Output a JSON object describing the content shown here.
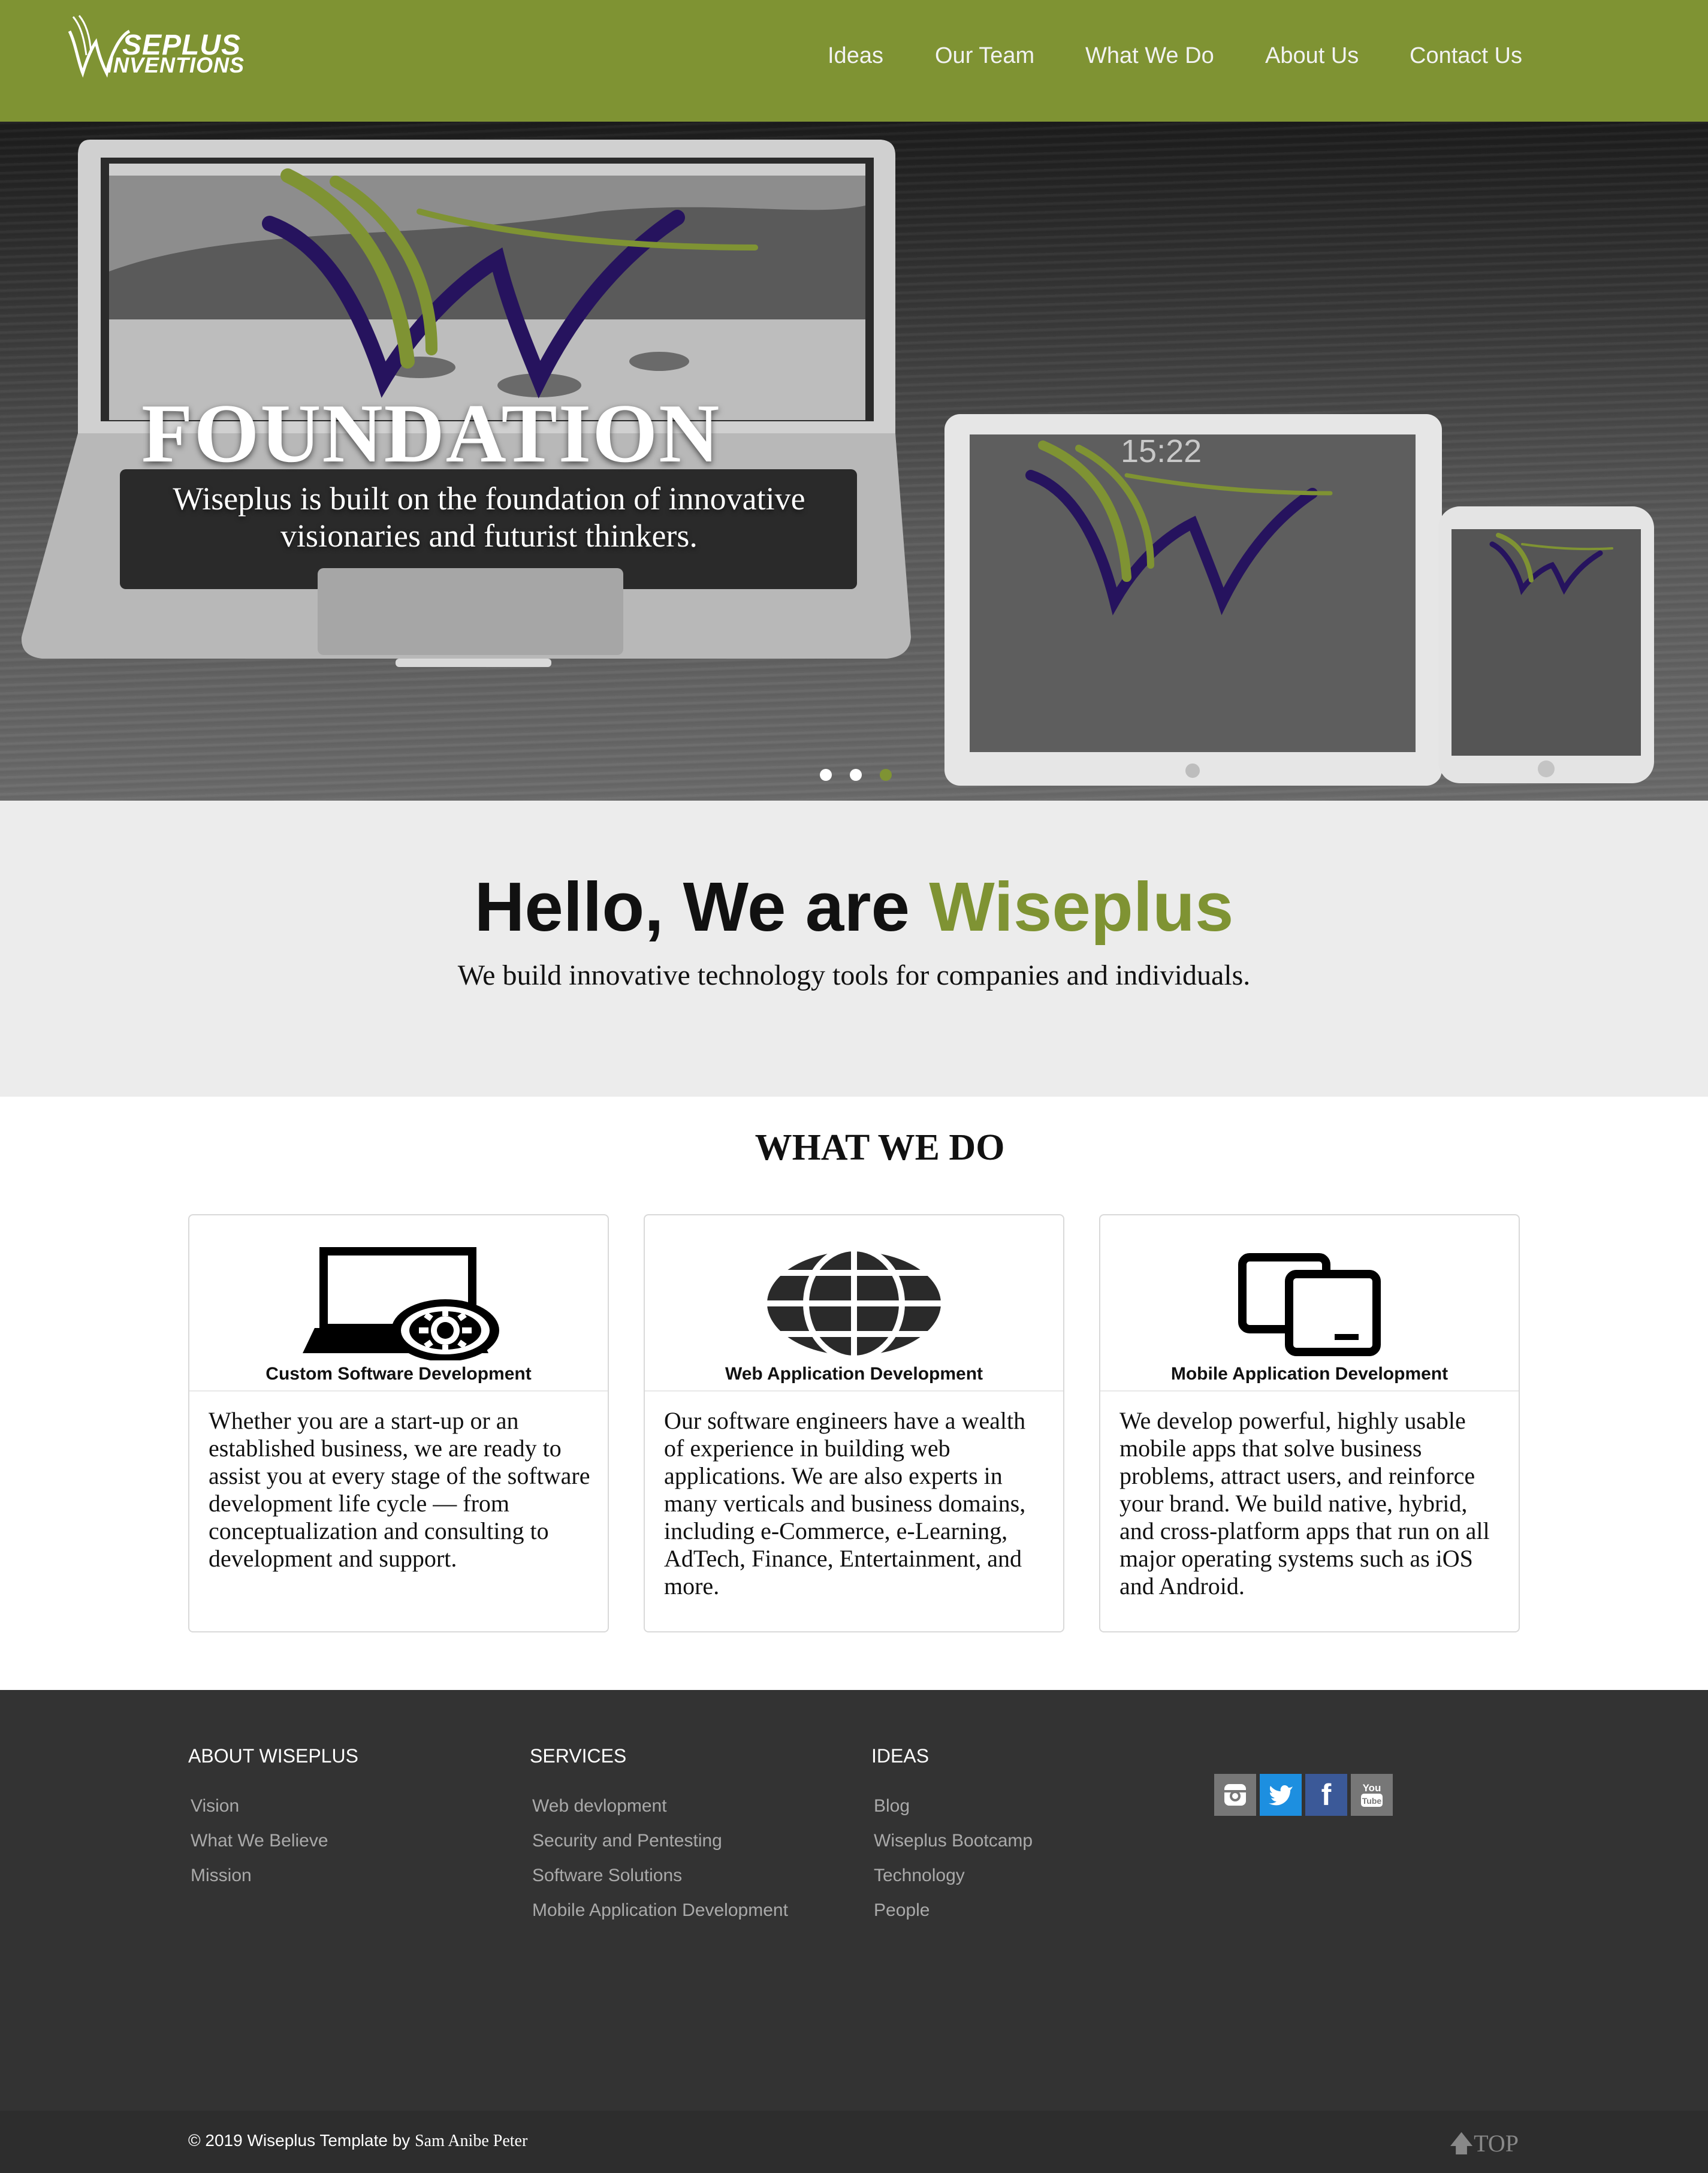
{
  "brand": {
    "logo_line1": "SEPLUS",
    "logo_line2": "INVENTIONS",
    "accent": "#7f9333",
    "dark": "#333333"
  },
  "nav": {
    "items": [
      {
        "label": "Ideas"
      },
      {
        "label": "Our Team"
      },
      {
        "label": "What We Do"
      },
      {
        "label": "About Us"
      },
      {
        "label": "Contact Us"
      }
    ]
  },
  "hero": {
    "title": "FOUNDATION",
    "subtitle": "Wiseplus is built on the foundation of innovative visionaries and futurist thinkers.",
    "slides": 3,
    "active_slide": 3
  },
  "welcome": {
    "title_prefix": "Hello, We are ",
    "title_brand": "Wiseplus",
    "subtitle": "We build innovative technology tools for companies and individuals."
  },
  "what_we_do": {
    "title": "WHAT WE DO",
    "cards": [
      {
        "icon": "laptop-gear-icon",
        "title": "Custom Software Development",
        "body": "Whether you are a start-up or an established business, we are ready to assist you at every stage of the software development life cycle — from conceptualization and consulting to development and support."
      },
      {
        "icon": "globe-icon",
        "title": "Web Application Development",
        "body": "Our software engineers have a wealth of experience in building web applications. We are also experts in many verticals and business domains, including e-Commerce, e-Learning, AdTech, Finance, Entertainment, and more."
      },
      {
        "icon": "devices-icon",
        "title": "Mobile Application Development",
        "body": "We develop powerful, highly usable mobile apps that solve business problems, attract users, and reinforce your brand. We build native, hybrid, and cross-platform apps that run on all major operating systems such as iOS and Android."
      }
    ]
  },
  "footer": {
    "columns": [
      {
        "heading": "ABOUT WISEPLUS",
        "links": [
          "Vision",
          "What We Believe",
          "Mission"
        ]
      },
      {
        "heading": "SERVICES",
        "links": [
          "Web devlopment",
          "Security and Pentesting",
          "Software Solutions",
          "Mobile Application Development"
        ]
      },
      {
        "heading": "IDEAS",
        "links": [
          "Blog",
          "Wiseplus Bootcamp",
          "Technology",
          "People"
        ]
      }
    ],
    "social": [
      {
        "icon": "instagram-icon",
        "color": "#777777"
      },
      {
        "icon": "twitter-icon",
        "color": "#1d8fe0"
      },
      {
        "icon": "facebook-icon",
        "color": "#3b5998"
      },
      {
        "icon": "youtube-icon",
        "color": "#777777"
      }
    ],
    "copyright": "© 2019 Wiseplus Template by ",
    "author": "Sam Anibe Peter",
    "top_label": "TOP"
  }
}
